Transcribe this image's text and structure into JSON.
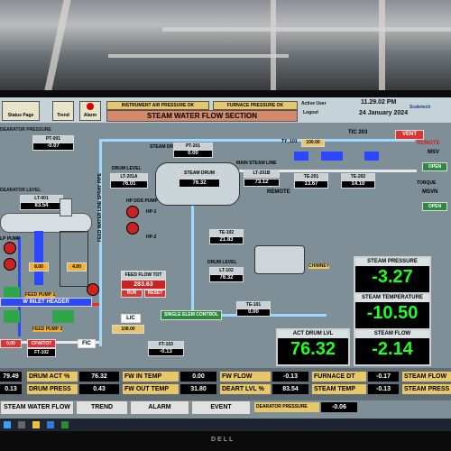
{
  "header": {
    "tabs": [
      "Status Page",
      "Trend",
      "Alarm"
    ],
    "instrument_air": "INSTRUMENT AIR PRESSURE OK",
    "furnace_pressure": "FURNACE PRESSURE OK",
    "section_title": "STEAM WATER FLOW SECTION",
    "active_user_label": "Active User",
    "user_name": "Logout",
    "time": "11.29.02 PM",
    "date": "24 January 2024",
    "brand": "Scaletech"
  },
  "tags": {
    "deaerator_pressure": {
      "label": "DEARATOR PRESSURE",
      "id": "PT-001",
      "value": "-0.07"
    },
    "deaerator_level": {
      "label": "DEARATOR LEVEL",
      "id": "LT-001",
      "value": "83.54"
    },
    "steam_drum_pressure": {
      "id": "PT-201",
      "value": "0.00"
    },
    "drum_level": {
      "label": "DRUM LEVEL",
      "id": "LT-201A",
      "value": "76.01"
    },
    "lt_201b": {
      "id": "LT-201B",
      "value": "73.12"
    },
    "steam_drum": {
      "label": "STEAM DRUM",
      "value": "76.32"
    },
    "te_201": {
      "id": "TE-201",
      "value": "13.67"
    },
    "te_202": {
      "id": "TE-202",
      "value": "14.10"
    },
    "tic_203": "TIC 203",
    "ty_101": {
      "id": "TY_101",
      "value": "100.00"
    },
    "te_102": {
      "id": "TE-102",
      "value": "21.83"
    },
    "lt_102": {
      "label": "DRUM LEVEL",
      "id": "LT-102",
      "value": "76.32"
    },
    "te_101": {
      "id": "TE-101",
      "value": "0.00"
    },
    "ft_103": {
      "id": "FT-103",
      "value": "-0.13"
    },
    "lic": {
      "label": "LIC",
      "value": "108.00"
    },
    "feed_flow_tot": {
      "label": "FEED FLOW TOT",
      "value": "283.63"
    },
    "pump_run": "RUN",
    "pump_reset": "RESET",
    "single_elem": "SINGLE ELEM CONTROL",
    "fic": "FIC",
    "hp_dos_pump": "HP DOS PUMP",
    "hp_1": "HP-1",
    "hp_2": "HP-2",
    "remote": "REMOTE",
    "main_steam_line": "MAIN STEAM LINE",
    "feed_pump": "FEED PUMP 1",
    "feed_pump_2": "FEED PUMP 2",
    "inlet_header": "W INLET HEADER",
    "feed_water_line": "FEED WATER LINE SPRAY PIPE",
    "chimney": "CHIMNEY",
    "small_vals": [
      "8.00",
      "4.00",
      "0.00"
    ],
    "cfw_tot": "CFW/TOT"
  },
  "right_panel": {
    "vent": "VENT",
    "remote": "REMOTE",
    "msv": "MSV",
    "open": "OPEN",
    "torque": "TORQUE",
    "msvn": "MSVN"
  },
  "big_values": {
    "steam_pressure": {
      "label": "STEAM PRESSURE",
      "value": "-3.27"
    },
    "steam_temperature": {
      "label": "STEAM TEMPERATURE",
      "value": "-10.50"
    },
    "act_drum_lvl": {
      "label": "ACT DRUM LVL",
      "value": "76.32"
    },
    "steam_flow": {
      "label": "STEAM FLOW",
      "value": "-2.14"
    }
  },
  "bottom": {
    "rows": [
      [
        {
          "label": "79.49"
        },
        {
          "label": "DRUM ACT %",
          "value": "76.32"
        },
        {
          "label": "FW IN TEMP",
          "value": "0.00"
        },
        {
          "label": "FW FLOW",
          "value": "-0.13"
        },
        {
          "label": "FURNACE DT",
          "value": "-0.17"
        },
        {
          "label": "STEAM FLOW",
          "value": ""
        }
      ],
      [
        {
          "label": "0.13"
        },
        {
          "label": "DRUM PRESS",
          "value": "0.43"
        },
        {
          "label": "FW OUT TEMP",
          "value": "31.80"
        },
        {
          "label": "DEART LVL %",
          "value": "83.54"
        },
        {
          "label": "STEAM TEMP",
          "value": "-0.13"
        },
        {
          "label": "STEAM PRESS",
          "value": ""
        }
      ]
    ],
    "extra": "DEARATOR PRESSURE",
    "extra_value": "-0.06"
  },
  "nav": [
    "STEAM WATER FLOW",
    "TREND",
    "ALARM",
    "EVENT"
  ],
  "bezel_brand": "DELL"
}
